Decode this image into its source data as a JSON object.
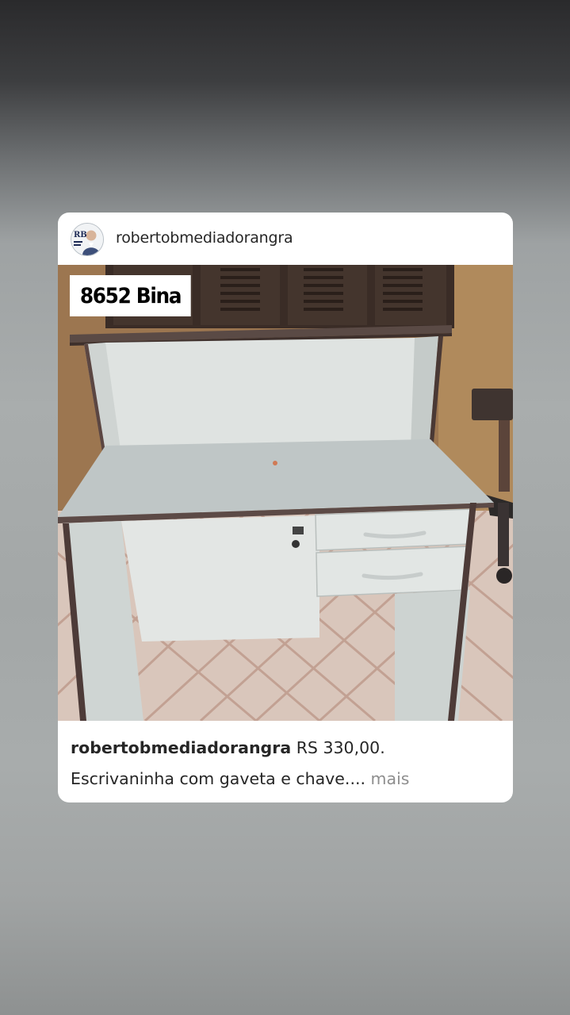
{
  "post": {
    "username": "robertobmediadorangra",
    "image_tag": "8652 Bina",
    "caption": {
      "username": "robertobmediadorangra",
      "price": "RS 330,00.",
      "description": "Escrivaninha com gaveta e chave.",
      "ellipsis": "...",
      "more_label": "mais"
    },
    "avatar_initials": "RB"
  },
  "colors": {
    "card_background": "#ffffff",
    "text_primary": "#262626",
    "text_secondary": "#8e8e8e"
  }
}
